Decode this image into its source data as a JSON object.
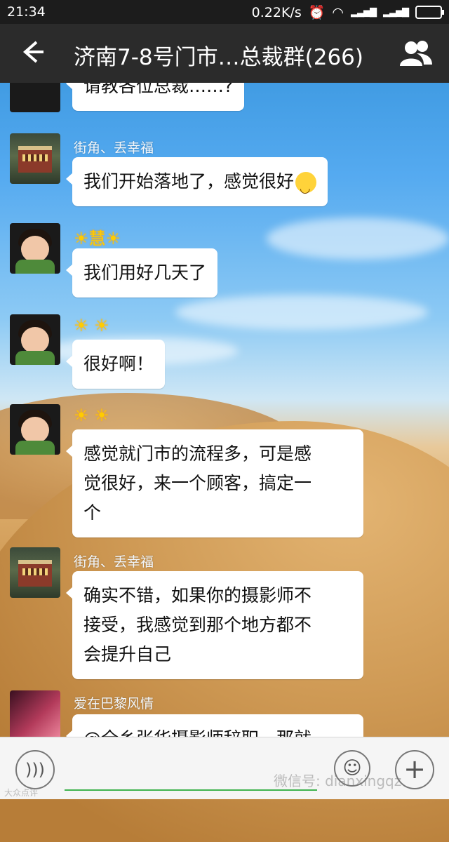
{
  "status_bar": {
    "time": "21:34",
    "network_speed": "0.22K/s",
    "icons": [
      "alarm-icon",
      "wifi-icon",
      "signal-icon",
      "signal-icon",
      "battery-icon"
    ]
  },
  "header": {
    "back_icon": "arrow-left-icon",
    "title": "济南7-8号门市…总裁群(266)",
    "members_icon": "group-members-icon"
  },
  "messages": [
    {
      "sender": "",
      "text": "请教各位总裁……?",
      "avatar": "avatar-partial"
    },
    {
      "sender": "街角、丢幸福",
      "text": "我们开始落地了，感觉很好",
      "emoji": "smile-emoji-icon",
      "avatar": "avatar-building"
    },
    {
      "sender": "☀慧☀",
      "text": "我们用好几天了",
      "avatar": "avatar-girl"
    },
    {
      "sender": "☀ ☀",
      "text": "很好啊！",
      "avatar": "avatar-girl"
    },
    {
      "sender": "☀ ☀",
      "lines": [
        "感觉就门市的流程多，可是感",
        "觉很好，来一个顾客，搞定一",
        "个"
      ],
      "avatar": "avatar-girl"
    },
    {
      "sender": "街角、丢幸福",
      "lines": [
        "确实不错，如果你的摄影师不",
        "接受，我感觉到那个地方都不",
        "会提升自己"
      ],
      "avatar": "avatar-building"
    },
    {
      "sender": "爱在巴黎风情",
      "text": "@全乡张华摄影师辞职，那就",
      "avatar": "avatar-woman"
    }
  ],
  "input_bar": {
    "voice_icon": "voice-icon",
    "emoji_icon": "emoji-icon",
    "plus_icon": "plus-icon",
    "watermark": "微信号: dianxingqz",
    "watermark_small": "大众点评"
  }
}
